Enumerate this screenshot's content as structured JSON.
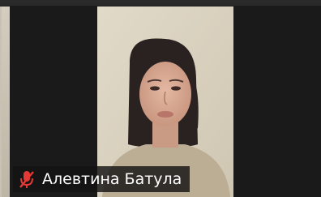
{
  "participant": {
    "name": "Алевтина Батула",
    "mic_icon": "mic-muted-icon",
    "mic_state": "muted"
  },
  "colors": {
    "background": "#1a1a1a",
    "mute_icon": "#e53935",
    "label_text": "#ffffff",
    "label_background": "#141414"
  }
}
